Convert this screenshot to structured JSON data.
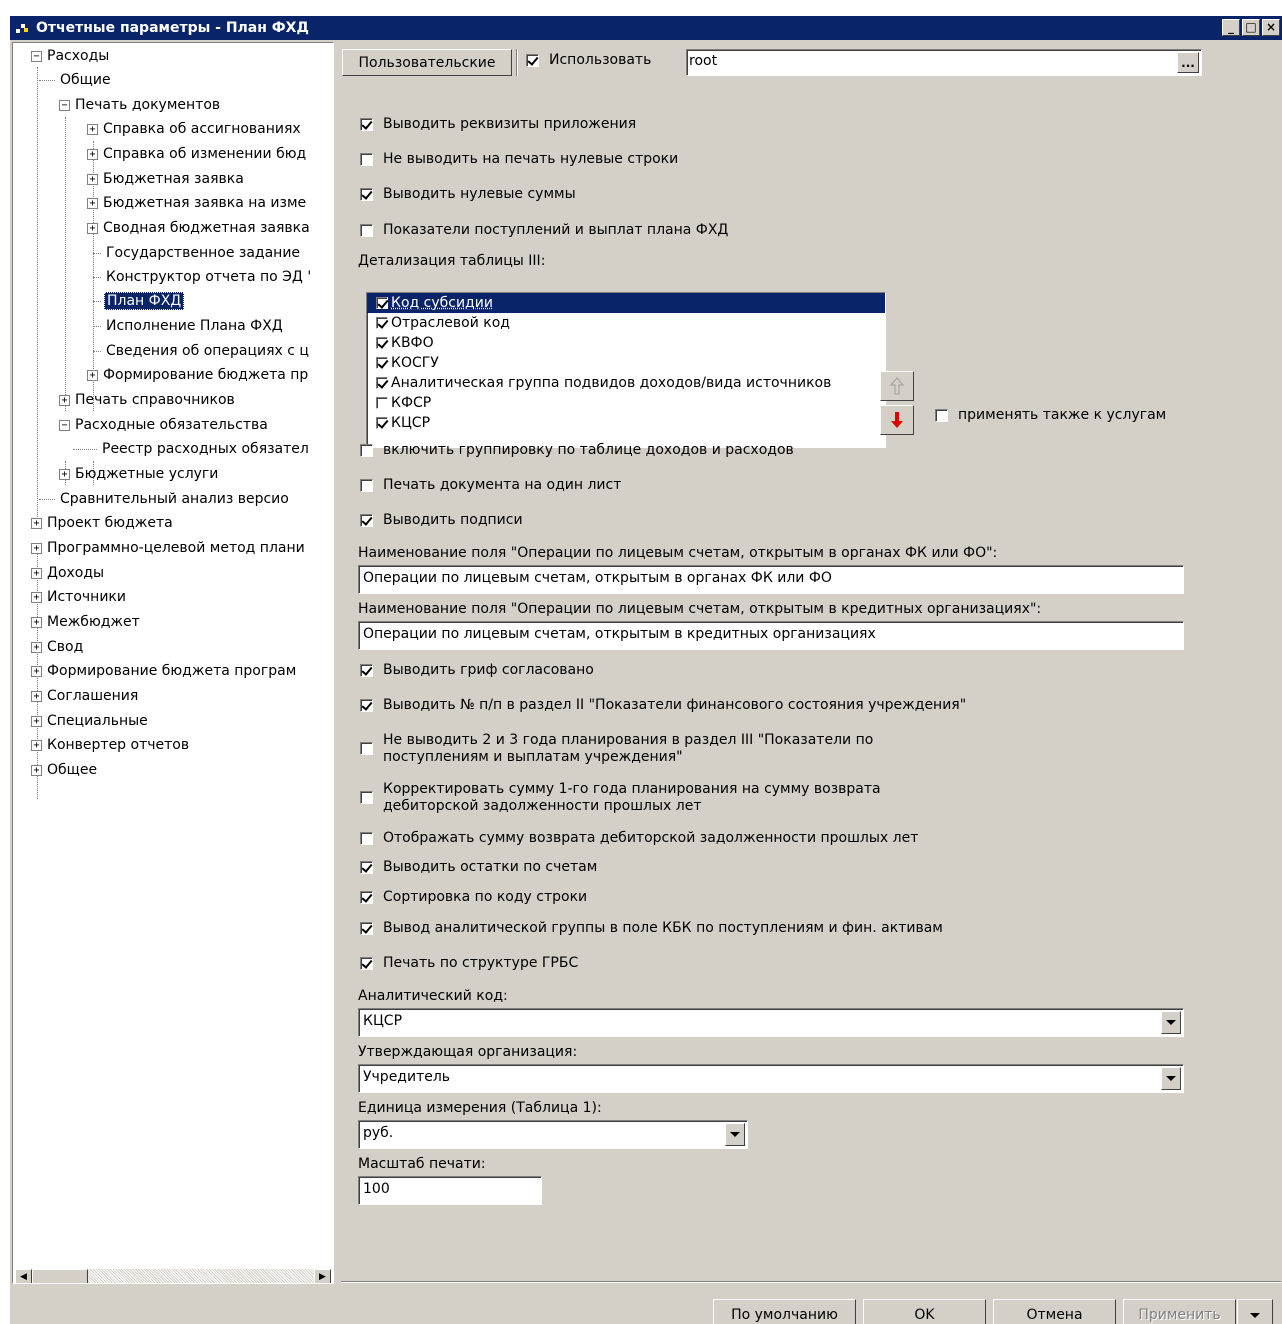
{
  "window": {
    "title": "Отчетные параметры - План ФХД",
    "minimize": "_",
    "maximize": "□",
    "close": "×"
  },
  "tree": {
    "items": [
      {
        "label": "Расходы",
        "expander": "−"
      },
      {
        "label": "Общие"
      },
      {
        "label": "Печать документов",
        "expander": "−"
      },
      {
        "label": "Справка об ассигнованиях",
        "expander": "+"
      },
      {
        "label": "Справка об изменении бюд",
        "expander": "+"
      },
      {
        "label": "Бюджетная заявка",
        "expander": "+"
      },
      {
        "label": "Бюджетная заявка на изме",
        "expander": "+"
      },
      {
        "label": "Сводная бюджетная заявка",
        "expander": "+"
      },
      {
        "label": "Государственное задание"
      },
      {
        "label": "Конструктор отчета по ЭД '"
      },
      {
        "label": "План ФХД",
        "selected": true
      },
      {
        "label": "Исполнение Плана ФХД"
      },
      {
        "label": "Сведения об операциях с ц"
      },
      {
        "label": "Формирование бюджета пр",
        "expander": "+"
      },
      {
        "label": "Печать справочников",
        "expander": "+"
      },
      {
        "label": "Расходные обязательства",
        "expander": "−"
      },
      {
        "label": "Реестр расходных обязател"
      },
      {
        "label": "Бюджетные услуги",
        "expander": "+"
      },
      {
        "label": "Сравнительный анализ версио"
      },
      {
        "label": "Проект бюджета",
        "expander": "+"
      },
      {
        "label": "Программно-целевой метод плани",
        "expander": "+"
      },
      {
        "label": "Доходы",
        "expander": "+"
      },
      {
        "label": "Источники",
        "expander": "+"
      },
      {
        "label": "Межбюджет",
        "expander": "+"
      },
      {
        "label": "Свод",
        "expander": "+"
      },
      {
        "label": "Формирование бюджета програм",
        "expander": "+"
      },
      {
        "label": "Соглашения",
        "expander": "+"
      },
      {
        "label": "Специальные",
        "expander": "+"
      },
      {
        "label": "Конвертер отчетов",
        "expander": "+"
      },
      {
        "label": "Общее",
        "expander": "+"
      }
    ],
    "scroll_left": "◀",
    "scroll_right": "▶"
  },
  "header": {
    "tab_label": "Пользовательские",
    "use_label": "Использовать",
    "use_checked": true,
    "user_value": "root",
    "browse_label": "..."
  },
  "options": {
    "o1": {
      "label": "Выводить реквизиты приложения",
      "checked": true
    },
    "o2": {
      "label": "Не выводить на печать нулевые строки",
      "checked": false
    },
    "o3": {
      "label": "Выводить нулевые суммы",
      "checked": true
    },
    "o4": {
      "label": "Показатели поступлений и выплат плана ФХД",
      "checked": false
    },
    "detail_label": "Детализация таблицы III:",
    "detail_items": [
      {
        "label": "Код субсидии",
        "checked": true,
        "selected": true
      },
      {
        "label": "Отраслевой код",
        "checked": true
      },
      {
        "label": "КВФО",
        "checked": true
      },
      {
        "label": "КОСГУ",
        "checked": true
      },
      {
        "label": "Аналитическая группа подвидов доходов/вида источников",
        "checked": true
      },
      {
        "label": "КФСР",
        "checked": false
      },
      {
        "label": "КЦСР",
        "checked": true
      }
    ],
    "apply_services": {
      "label": "применять также к услугам",
      "checked": false
    },
    "o5": {
      "label": "включить группировку по таблице доходов и расходов",
      "checked": false
    },
    "o6": {
      "label": "Печать документа на один лист",
      "checked": false
    },
    "o7": {
      "label": "Выводить подписи",
      "checked": true
    },
    "fk_label": "Наименование поля \"Операции по лицевым счетам, открытым в органах ФК или ФО\":",
    "fk_value": "Операции по лицевым счетам, открытым в органах ФК или ФО",
    "credit_label": "Наименование поля \"Операции по лицевым счетам, открытым в кредитных организациях\":",
    "credit_value": "Операции по лицевым счетам, открытым в кредитных организациях",
    "o8": {
      "label": "Выводить гриф согласовано",
      "checked": true
    },
    "o9": {
      "label": "Выводить № п/п в раздел II \"Показатели финансового состояния учреждения\"",
      "checked": true
    },
    "o10": {
      "label1": "Не выводить 2 и 3 года планирования в раздел III \"Показатели по",
      "label2": "поступлениям и выплатам учреждения\"",
      "checked": false
    },
    "o11": {
      "label1": "Корректировать сумму 1-го года планирования на сумму возврата",
      "label2": "дебиторской задолженности прошлых лет",
      "checked": false
    },
    "o12": {
      "label": "Отображать сумму возврата дебиторской задолженности прошлых лет",
      "checked": false
    },
    "o13": {
      "label": "Выводить остатки по счетам",
      "checked": true
    },
    "o14": {
      "label": "Сортировка по коду строки",
      "checked": true
    },
    "o15": {
      "label": "Вывод аналитической группы в поле КБК по поступлениям и фин. активам",
      "checked": true
    },
    "o16": {
      "label": "Печать по структуре ГРБС",
      "checked": true
    },
    "analytic_label": "Аналитический код:",
    "analytic_value": "КЦСР",
    "approve_label": "Утверждающая организация:",
    "approve_value": "Учредитель",
    "unit_label": "Единица измерения (Таблица 1):",
    "unit_value": "руб.",
    "scale_label": "Масштаб печати:",
    "scale_value": "100"
  },
  "buttons": {
    "default": "По умолчанию",
    "ok": "OK",
    "cancel": "Отмена",
    "apply": "Применить"
  },
  "colors": {
    "titlebar": "#0a246a",
    "face": "#d4d0c8",
    "selection": "#0a246a",
    "arrow_red": "#e00000"
  }
}
